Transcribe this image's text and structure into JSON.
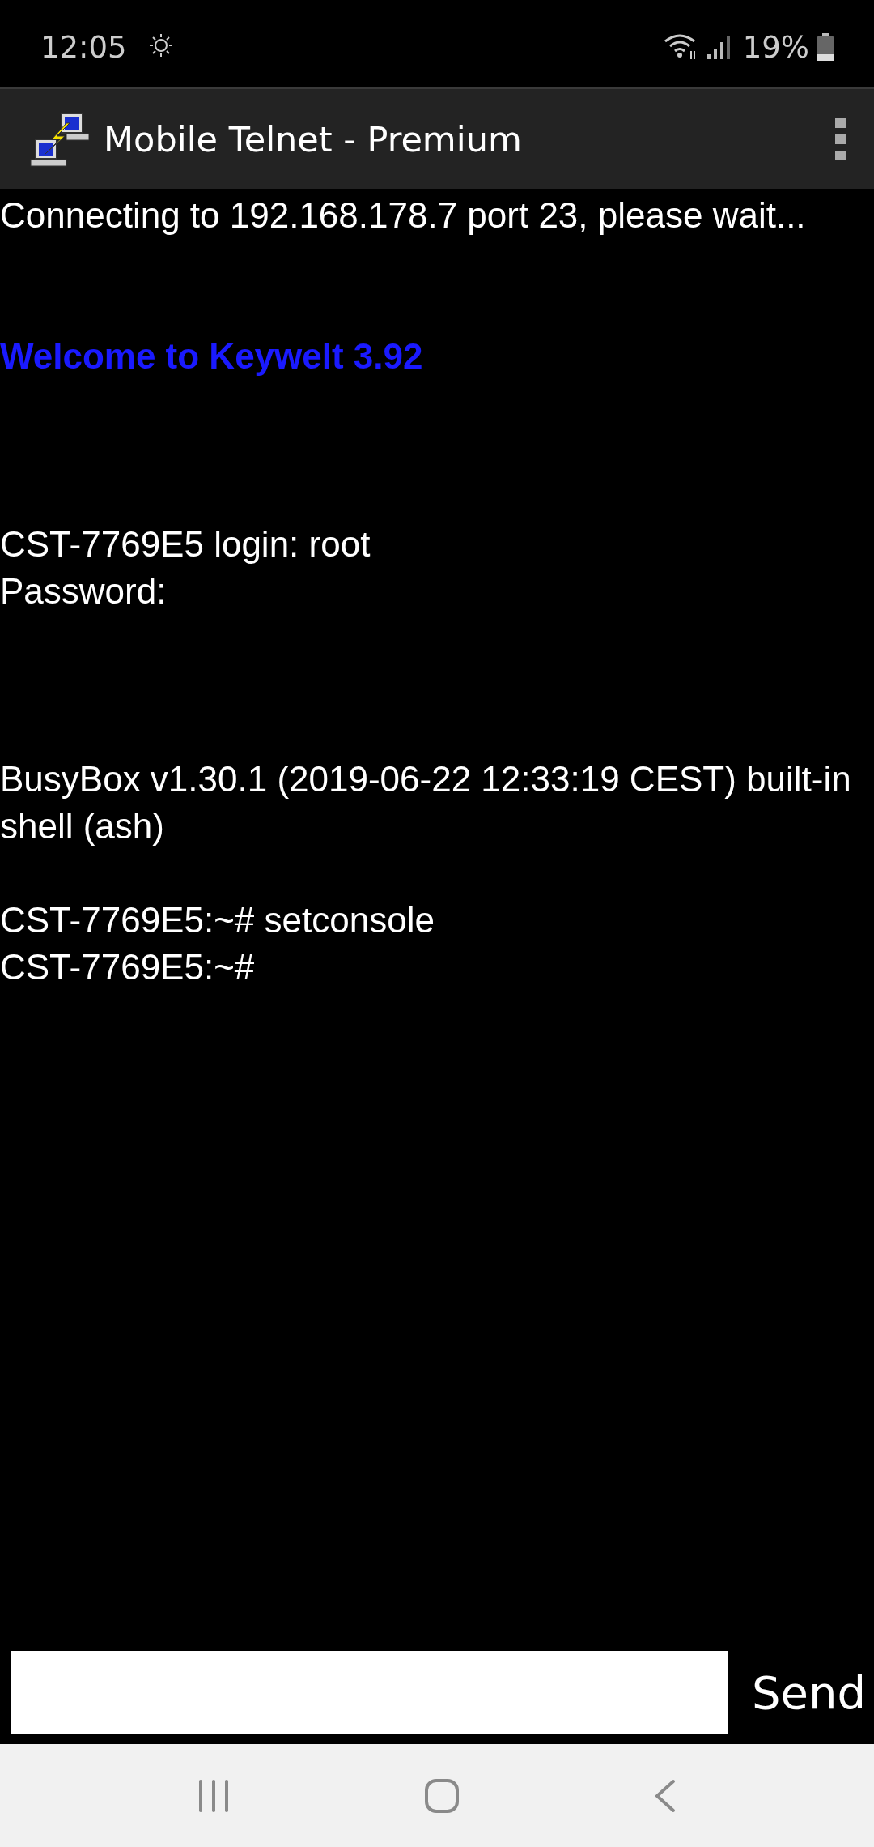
{
  "status_bar": {
    "time": "12:05",
    "battery": "19%"
  },
  "app_bar": {
    "title": "Mobile Telnet - Premium"
  },
  "terminal": {
    "lines": [
      {
        "kind": "text",
        "text": "Connecting to 192.168.178.7 port 23, please wait..."
      },
      {
        "kind": "blank"
      },
      {
        "kind": "blank"
      },
      {
        "kind": "highlight",
        "text": "Welcome to Keywelt 3.92"
      },
      {
        "kind": "blank"
      },
      {
        "kind": "blank"
      },
      {
        "kind": "blank"
      },
      {
        "kind": "text",
        "text": "CST-7769E5 login: root"
      },
      {
        "kind": "text",
        "text": "Password:"
      },
      {
        "kind": "blank"
      },
      {
        "kind": "blank"
      },
      {
        "kind": "blank"
      },
      {
        "kind": "text",
        "text": "BusyBox v1.30.1 (2019-06-22 12:33:19 CEST) built-in shell (ash)"
      },
      {
        "kind": "blank"
      },
      {
        "kind": "text",
        "text": "CST-7769E5:~# setconsole"
      },
      {
        "kind": "text",
        "text": "CST-7769E5:~#"
      }
    ]
  },
  "input": {
    "send_label": "Send"
  }
}
